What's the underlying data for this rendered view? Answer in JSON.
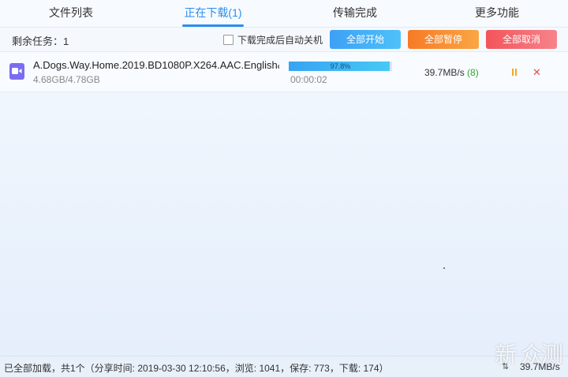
{
  "tabs": [
    {
      "label": "文件列表"
    },
    {
      "label": "正在下载(1)"
    },
    {
      "label": "传输完成"
    },
    {
      "label": "更多功能"
    }
  ],
  "toolbar": {
    "remaining": "剩余任务：1",
    "auto_shutdown_label": "下载完成后自动关机",
    "start_all": "全部开始",
    "pause_all": "全部暂停",
    "cancel_all": "全部取消"
  },
  "download": {
    "file_name": "A.Dogs.Way.Home.2019.BD1080P.X264.AAC.English&...",
    "size": "4.68GB/4.78GB",
    "progress_text": "97.8%",
    "progress_value": 97.8,
    "elapsed": "00:00:02",
    "speed": "39.7MB/s",
    "peers": "(8)"
  },
  "status_bar": {
    "info": "已全部加载，共1个（分享时间: 2019-03-30 12:10:56，浏览: 1041，保存: 773，下载: 174）",
    "speed": "39.7MB/s"
  },
  "watermark": "新 众测",
  "colors": {
    "accent": "#2a8ef0",
    "start": "#3da0f6",
    "pause": "#f77a26",
    "cancel": "#f2555a"
  }
}
